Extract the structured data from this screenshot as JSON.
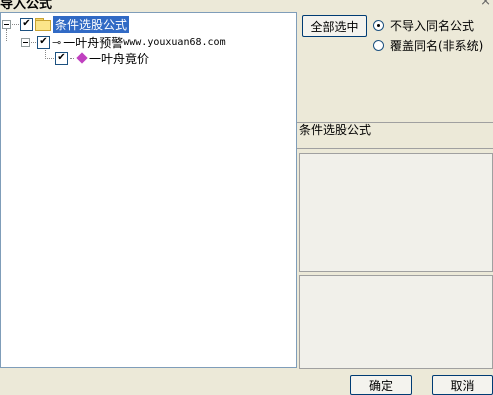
{
  "window": {
    "title": "导入公式",
    "close_glyph": "×"
  },
  "tree": {
    "root": {
      "label": "条件选股公式",
      "checked": "✔"
    },
    "child": {
      "label": "一叶舟预警",
      "suffix": "www.youxuan68.com",
      "checked": "✔"
    },
    "grandchild": {
      "label": "一叶舟竟价",
      "checked": "✔"
    }
  },
  "actions": {
    "select_all": "全部选中",
    "ok": "确定",
    "cancel": "取消"
  },
  "options": {
    "no_import_same": "不导入同名公式",
    "overwrite_same": "覆盖同名(非系统)",
    "selected": "no_import_same"
  },
  "info": {
    "category": "条件选股公式"
  }
}
